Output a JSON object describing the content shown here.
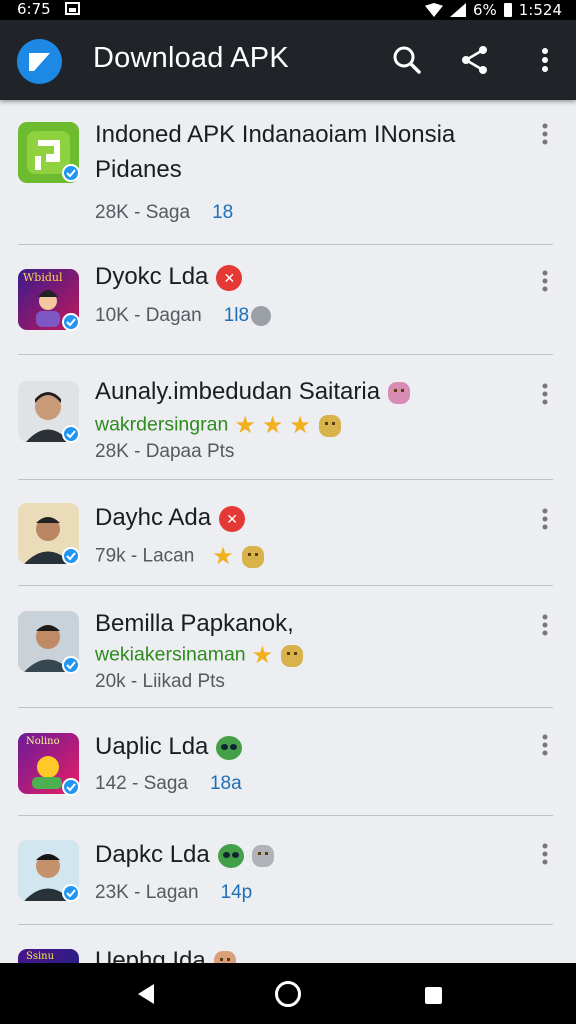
{
  "status_bar": {
    "time": "6:75",
    "battery": "6%",
    "clock": "1:524"
  },
  "app_bar": {
    "title": "Download APK",
    "actions": [
      "search-icon",
      "share-icon",
      "more-vert-icon"
    ],
    "accent": "#1e88e5"
  },
  "apps": [
    {
      "name": "Indoned APK Indanaoiam INonsia",
      "name2": "Pidanes",
      "meta": "28K - Saga",
      "count": "18",
      "verified": true
    },
    {
      "name": "Dyokc Lda",
      "badge": "red",
      "meta": "10K - Dagan",
      "count": "1l8",
      "icon_label": "Wbidul",
      "verified": true
    },
    {
      "name": "Aunaly.imbedudan Saitaria",
      "subtitle": "wakrdersingran",
      "meta": "28K - Dapaa  Pts",
      "verified": true
    },
    {
      "name": "Dayhc Ada",
      "badge": "red",
      "meta": "79k - Lacan",
      "verified": true
    },
    {
      "name": "Bemilla Papkanok,",
      "subtitle": "wekiakersinaman",
      "meta": "20k - Liikad  Pts",
      "verified": true
    },
    {
      "name": "Uaplic Lda",
      "badge": "green",
      "meta": "142 - Saga",
      "count": "18a",
      "icon_label": "Nolino",
      "verified": true
    },
    {
      "name": "Dapkc Lda",
      "badge": "green",
      "meta": "23K - Lagan",
      "count": "14p",
      "verified": true
    },
    {
      "name": "Uephg Ida",
      "icon_label": "Ssinu",
      "verified": true
    }
  ],
  "colors": {
    "verified": "#2196f3",
    "subtitle_green": "#2e8b1e",
    "count_blue": "#1c6fb8"
  }
}
